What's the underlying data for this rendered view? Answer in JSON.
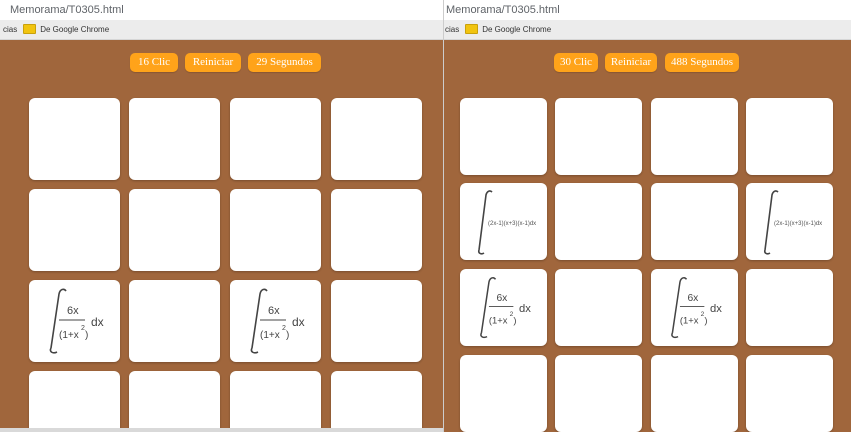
{
  "left": {
    "url": "Memorama/T0305.html",
    "bookmarks": {
      "apps_fragment": "cias",
      "folder_label": "De Google Chrome"
    },
    "buttons": {
      "clicks": "16 Clic",
      "restart": "Reiniciar",
      "time": "29 Segundos"
    },
    "cards": [
      {
        "face": "blank"
      },
      {
        "face": "blank"
      },
      {
        "face": "blank"
      },
      {
        "face": "blank"
      },
      {
        "face": "blank"
      },
      {
        "face": "blank"
      },
      {
        "face": "blank"
      },
      {
        "face": "blank"
      },
      {
        "face": "integral-6x"
      },
      {
        "face": "blank"
      },
      {
        "face": "integral-6x"
      },
      {
        "face": "blank"
      },
      {
        "face": "blank"
      },
      {
        "face": "blank"
      },
      {
        "face": "blank"
      },
      {
        "face": "blank"
      }
    ]
  },
  "right": {
    "url": "Memorama/T0305.html",
    "bookmarks": {
      "apps_fragment": "cias",
      "folder_label": "De Google Chrome"
    },
    "buttons": {
      "clicks": "30 Clic",
      "restart": "Reiniciar",
      "time": "488 Segundos"
    },
    "cards": [
      {
        "face": "blank"
      },
      {
        "face": "blank"
      },
      {
        "face": "blank"
      },
      {
        "face": "blank"
      },
      {
        "face": "integral-small"
      },
      {
        "face": "blank"
      },
      {
        "face": "blank"
      },
      {
        "face": "integral-small"
      },
      {
        "face": "integral-6x"
      },
      {
        "face": "blank"
      },
      {
        "face": "integral-6x"
      },
      {
        "face": "blank"
      },
      {
        "face": "blank"
      },
      {
        "face": "blank"
      },
      {
        "face": "blank"
      },
      {
        "face": "blank"
      }
    ]
  },
  "math": {
    "numerator": "6x",
    "denominator": "(1+x",
    "exponent": "2",
    "close_paren": ")",
    "dx": "dx",
    "small_integrand": "(2x-1)(x+3)(x-1)dx"
  },
  "colors": {
    "page_bg": "#a0663c",
    "button_bg": "#ffa31a",
    "card_bg": "#ffffff"
  }
}
